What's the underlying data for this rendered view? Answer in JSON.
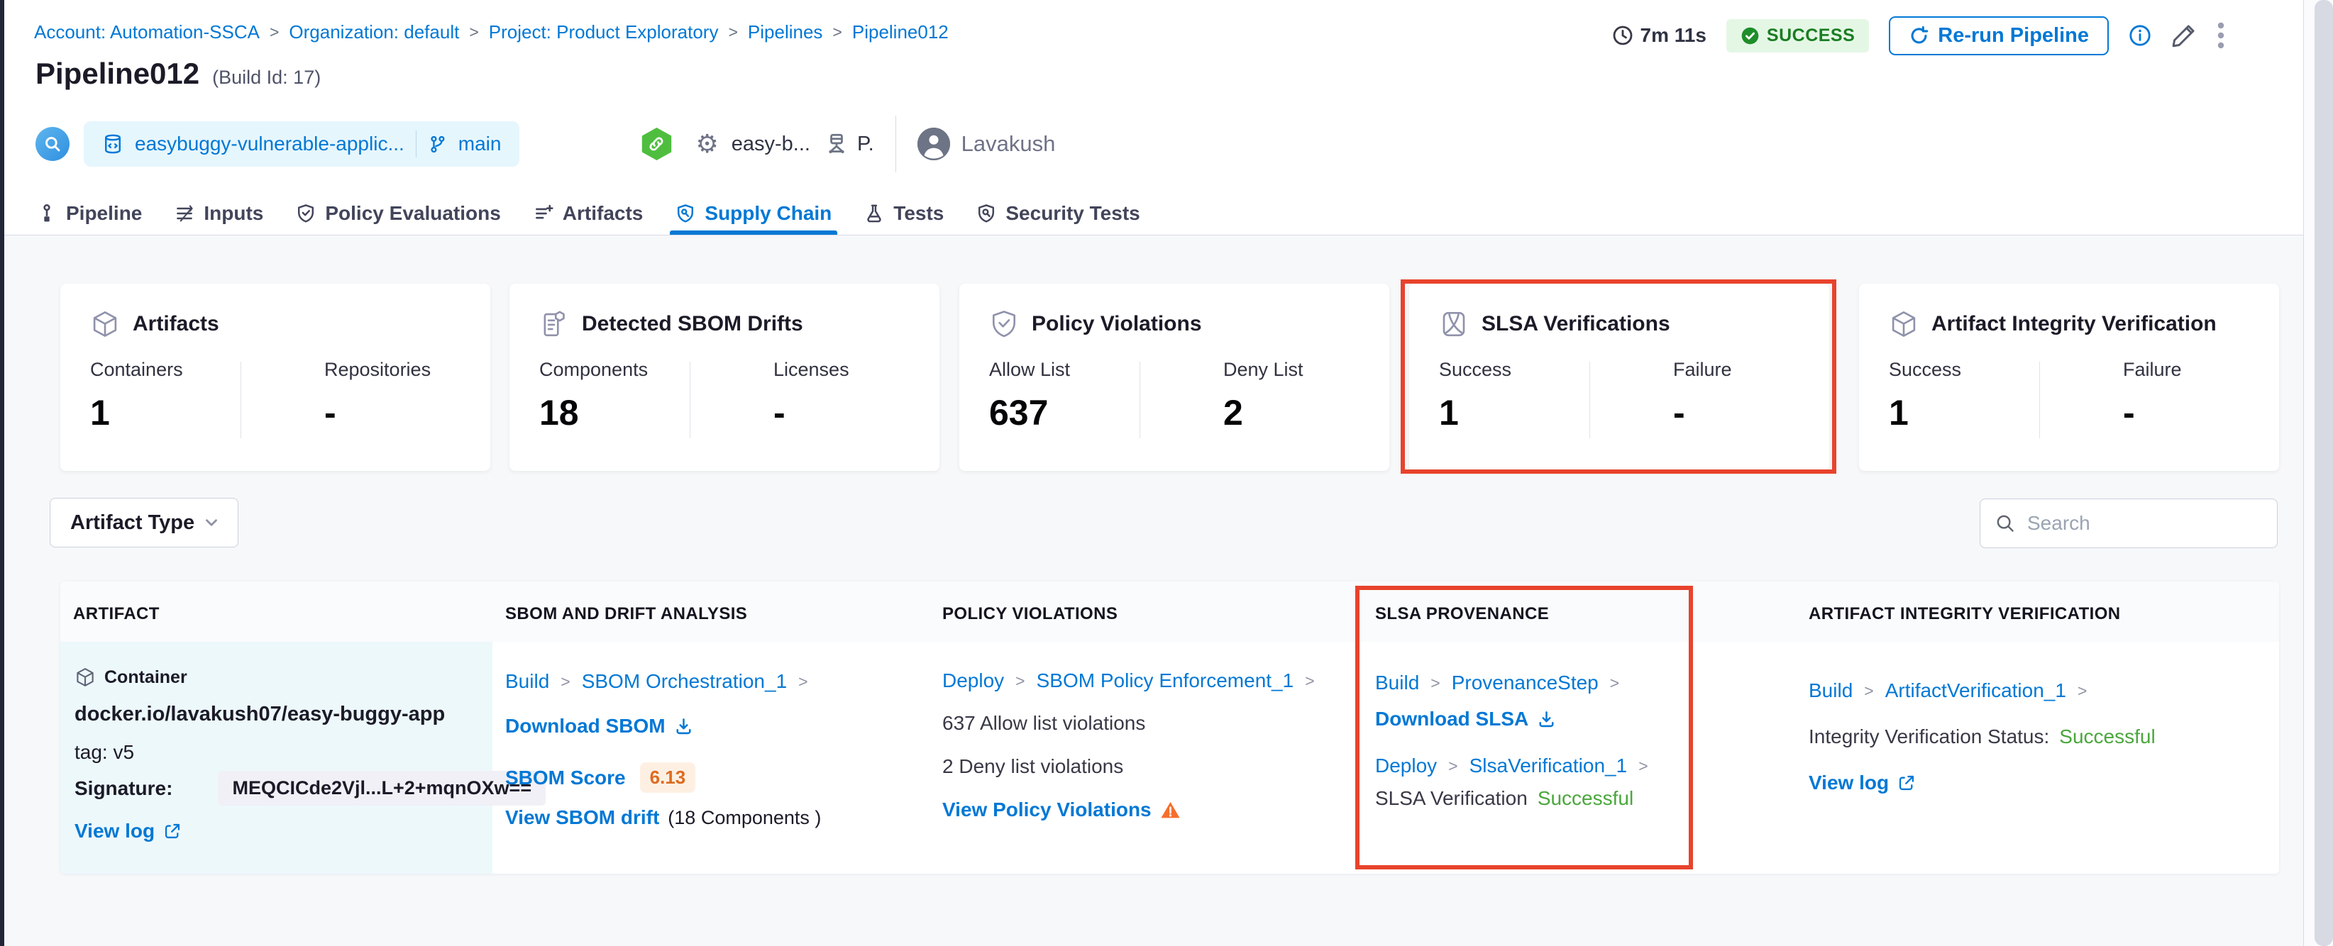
{
  "colors": {
    "primary_blue": "#0278d5",
    "success_badge_text": "#1b7d23",
    "success_badge_bg": "#e4f7e5",
    "success_text": "#4aa73c",
    "annotation_red": "#e8432c",
    "warning_orange": "#f76e2c",
    "score_orange": "#dd6b20",
    "page_bg": "#f6f8fa"
  },
  "breadcrumb": {
    "account": "Account: Automation-SSCA",
    "org": "Organization: default",
    "project": "Project: Product Exploratory",
    "pipelines": "Pipelines",
    "pipeline": "Pipeline012"
  },
  "topbar": {
    "duration": "7m 11s",
    "status": "SUCCESS",
    "rerun_button": "Re-run Pipeline"
  },
  "header": {
    "title": "Pipeline012",
    "build_id": "(Build Id: 17)",
    "repo_name": "easybuggy-vulnerable-applic...",
    "branch": "main",
    "service": "easy-b...",
    "env_abbrev": "P.",
    "user": "Lavakush"
  },
  "tabs": {
    "pipeline": "Pipeline",
    "inputs": "Inputs",
    "policy": "Policy Evaluations",
    "artifacts": "Artifacts",
    "supply_chain": "Supply Chain",
    "tests": "Tests",
    "security_tests": "Security Tests"
  },
  "cards": {
    "artifacts": {
      "title": "Artifacts",
      "stat1_label": "Containers",
      "stat1_value": "1",
      "stat2_label": "Repositories",
      "stat2_value": "-"
    },
    "sbom_drifts": {
      "title": "Detected SBOM Drifts",
      "stat1_label": "Components",
      "stat1_value": "18",
      "stat2_label": "Licenses",
      "stat2_value": "-"
    },
    "policy_violations": {
      "title": "Policy Violations",
      "stat1_label": "Allow List",
      "stat1_value": "637",
      "stat2_label": "Deny List",
      "stat2_value": "2"
    },
    "slsa": {
      "title": "SLSA Verifications",
      "stat1_label": "Success",
      "stat1_value": "1",
      "stat2_label": "Failure",
      "stat2_value": "-"
    },
    "integrity": {
      "title": "Artifact Integrity Verification",
      "stat1_label": "Success",
      "stat1_value": "1",
      "stat2_label": "Failure",
      "stat2_value": "-"
    }
  },
  "filters": {
    "artifact_type": "Artifact Type",
    "search_placeholder": "Search"
  },
  "table": {
    "headers": {
      "artifact": "ARTIFACT",
      "sbom": "SBOM AND DRIFT ANALYSIS",
      "policy": "POLICY VIOLATIONS",
      "slsa": "SLSA PROVENANCE",
      "integrity": "ARTIFACT INTEGRITY VERIFICATION"
    },
    "row": {
      "artifact": {
        "type": "Container",
        "image": "docker.io/lavakush07/easy-buggy-app",
        "tag": "tag: v5",
        "signature_label": "Signature:",
        "signature": "MEQCICde2Vjl...L+2+mqnOXw==",
        "view_log": "View log"
      },
      "sbom": {
        "stage": "Build",
        "step": "SBOM Orchestration_1",
        "download": "Download SBOM",
        "score_label": "SBOM Score",
        "score": "6.13",
        "drift_link": "View SBOM drift",
        "drift_note": "(18 Components )"
      },
      "policy": {
        "stage": "Deploy",
        "step": "SBOM Policy Enforcement_1",
        "allow": "637 Allow list violations",
        "deny": "2 Deny list violations",
        "link": "View Policy Violations"
      },
      "slsa": {
        "stage1": "Build",
        "step1": "ProvenanceStep",
        "download": "Download SLSA",
        "stage2": "Deploy",
        "step2": "SlsaVerification_1",
        "status_label": "SLSA Verification",
        "status_value": "Successful"
      },
      "integrity": {
        "stage": "Build",
        "step": "ArtifactVerification_1",
        "status_label": "Integrity Verification Status:",
        "status_value": "Successful",
        "view_log": "View log"
      }
    }
  }
}
